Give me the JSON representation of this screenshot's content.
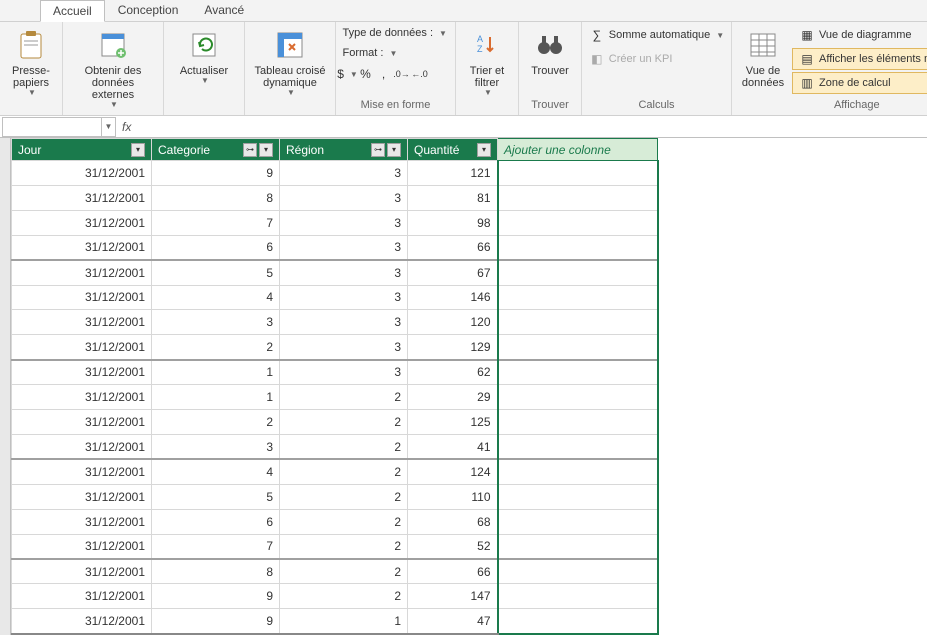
{
  "tabs": {
    "accueil": "Accueil",
    "conception": "Conception",
    "avance": "Avancé"
  },
  "ribbon": {
    "presse": "Presse-\npapiers",
    "obtenir": "Obtenir des\ndonnées externes",
    "actualiser": "Actualiser",
    "tcd": "Tableau croisé\ndynamique",
    "type_donnees": "Type de données :",
    "format": "Format :",
    "mise_en_forme": "Mise en forme",
    "trier": "Trier et\nfiltrer",
    "trouver_btn": "Trouver",
    "trouver_grp": "Trouver",
    "somme": "Somme automatique",
    "kpi": "Créer un KPI",
    "calculs": "Calculs",
    "vue_donnees": "Vue de\ndonnées",
    "vue_diag": "Vue de diagramme",
    "aff_masques": "Afficher les éléments masqués",
    "zone_calcul": "Zone de calcul",
    "affichage": "Affichage"
  },
  "fx_label": "fx",
  "headers": {
    "jour": "Jour",
    "categorie": "Categorie",
    "region": "Région",
    "quantite": "Quantité",
    "ajouter": "Ajouter une colonne"
  },
  "rows": [
    {
      "jour": "31/12/2001",
      "cat": "9",
      "reg": "3",
      "qte": "121",
      "sep": false
    },
    {
      "jour": "31/12/2001",
      "cat": "8",
      "reg": "3",
      "qte": "81",
      "sep": false
    },
    {
      "jour": "31/12/2001",
      "cat": "7",
      "reg": "3",
      "qte": "98",
      "sep": false
    },
    {
      "jour": "31/12/2001",
      "cat": "6",
      "reg": "3",
      "qte": "66",
      "sep": false
    },
    {
      "jour": "31/12/2001",
      "cat": "5",
      "reg": "3",
      "qte": "67",
      "sep": true
    },
    {
      "jour": "31/12/2001",
      "cat": "4",
      "reg": "3",
      "qte": "146",
      "sep": false
    },
    {
      "jour": "31/12/2001",
      "cat": "3",
      "reg": "3",
      "qte": "120",
      "sep": false
    },
    {
      "jour": "31/12/2001",
      "cat": "2",
      "reg": "3",
      "qte": "129",
      "sep": false
    },
    {
      "jour": "31/12/2001",
      "cat": "1",
      "reg": "3",
      "qte": "62",
      "sep": true
    },
    {
      "jour": "31/12/2001",
      "cat": "1",
      "reg": "2",
      "qte": "29",
      "sep": false
    },
    {
      "jour": "31/12/2001",
      "cat": "2",
      "reg": "2",
      "qte": "125",
      "sep": false
    },
    {
      "jour": "31/12/2001",
      "cat": "3",
      "reg": "2",
      "qte": "41",
      "sep": false
    },
    {
      "jour": "31/12/2001",
      "cat": "4",
      "reg": "2",
      "qte": "124",
      "sep": true
    },
    {
      "jour": "31/12/2001",
      "cat": "5",
      "reg": "2",
      "qte": "110",
      "sep": false
    },
    {
      "jour": "31/12/2001",
      "cat": "6",
      "reg": "2",
      "qte": "68",
      "sep": false
    },
    {
      "jour": "31/12/2001",
      "cat": "7",
      "reg": "2",
      "qte": "52",
      "sep": false
    },
    {
      "jour": "31/12/2001",
      "cat": "8",
      "reg": "2",
      "qte": "66",
      "sep": true
    },
    {
      "jour": "31/12/2001",
      "cat": "9",
      "reg": "2",
      "qte": "147",
      "sep": false
    },
    {
      "jour": "31/12/2001",
      "cat": "9",
      "reg": "1",
      "qte": "47",
      "sep": false
    }
  ]
}
